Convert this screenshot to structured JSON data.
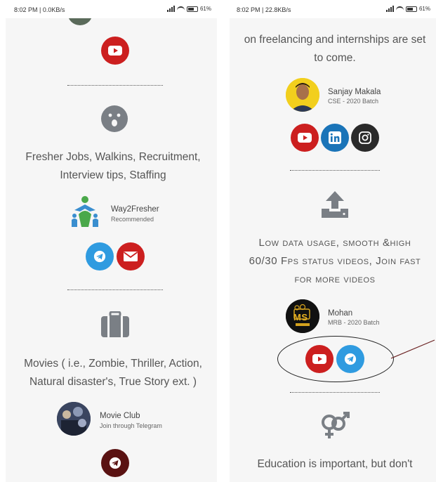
{
  "left": {
    "status": {
      "time_speed": "8:02 PM | 0.0KB/s",
      "battery": "61%"
    },
    "sections": [
      {
        "icon": "face-surprise-icon",
        "description": "Fresher Jobs, Walkins, Recruitment, Interview tips, Staffing",
        "channel": "Way2Fresher",
        "channel_sub": "Recommended"
      },
      {
        "icon": "briefcase-icon",
        "description": "Movies ( i.e., Zombie, Thriller, Action, Natural disaster's, True Story ext. )",
        "channel": "Movie Club",
        "channel_sub": "Join through Telegram"
      }
    ]
  },
  "right": {
    "status": {
      "time_speed": "8:02 PM | 22.8KB/s",
      "battery": "61%"
    },
    "top_text_partial": "on freelancing and internships are set to come.",
    "author1": {
      "name": "Sanjay Makala",
      "sub": "CSE - 2020 Batch"
    },
    "sections": [
      {
        "icon": "upload-icon",
        "description": "Low data usage, smooth &high 60/30 Fps status videos, Join fast for more videos",
        "channel": "Mohan",
        "channel_sub": "MRB - 2020 Batch",
        "logo_text": "MS"
      },
      {
        "icon": "gender-icon",
        "description_partial": "Education is important, but don't"
      }
    ]
  },
  "colors": {
    "youtube": "#cc1f1f",
    "telegram": "#2f9be0",
    "linkedin": "#1a74b8",
    "instagram": "#2a2a2a",
    "mail": "#cc1f1f"
  }
}
